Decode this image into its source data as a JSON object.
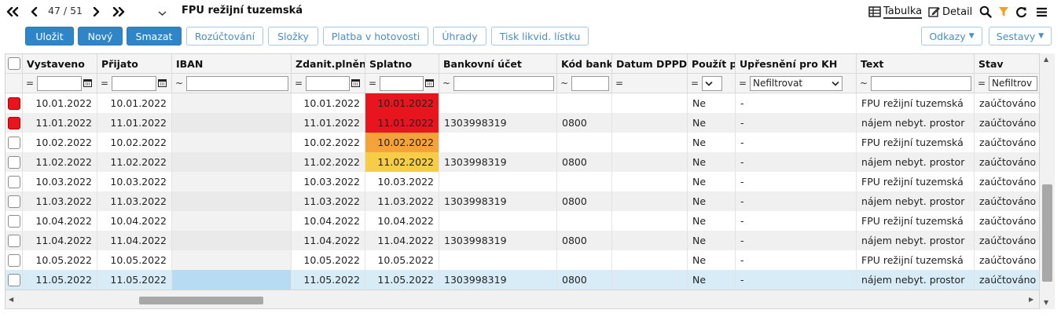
{
  "nav": {
    "counter": "47 / 51",
    "title": "FPU režijní tuzemská"
  },
  "views": {
    "table_label": "Tabulka",
    "detail_label": "Detail",
    "active": "Tabulka"
  },
  "toolbar": {
    "save_label": "Uložit",
    "new_label": "Nový",
    "delete_label": "Smazat",
    "allocation_label": "Rozúčtování",
    "folders_label": "Složky",
    "cash_payment_label": "Platba v hotovosti",
    "payments_label": "Úhrady",
    "print_label": "Tisk likvid. lístku",
    "links_label": "Odkazy",
    "reports_label": "Sestavy"
  },
  "colors": {
    "primary": "#2e86c9",
    "overdue_red": "#e8141e",
    "due_orange": "#f5a23a",
    "due_yellow": "#f7cc47",
    "filter_active": "#f0a21c"
  },
  "grid": {
    "columns": [
      {
        "key": "vystaveno",
        "label": "Vystaveno"
      },
      {
        "key": "prijato",
        "label": "Přijato"
      },
      {
        "key": "iban",
        "label": "IBAN"
      },
      {
        "key": "zdanit",
        "label": "Zdanit.plnění"
      },
      {
        "key": "splatno",
        "label": "Splatno"
      },
      {
        "key": "ucet",
        "label": "Bankovní účet"
      },
      {
        "key": "kod",
        "label": "Kód banky"
      },
      {
        "key": "dppd",
        "label": "Datum DPPD"
      },
      {
        "key": "pouzit",
        "label": "Použít po"
      },
      {
        "key": "kh",
        "label": "Upřesnění pro KH"
      },
      {
        "key": "text",
        "label": "Text"
      },
      {
        "key": "stav",
        "label": "Stav"
      }
    ],
    "filters": {
      "op_equals": "=",
      "op_like": "~",
      "kh_value": "Nefiltrovat",
      "stav_value": "Nefiltrov"
    },
    "rows": [
      {
        "mark": "red",
        "vystaveno": "10.01.2022",
        "prijato": "10.01.2022",
        "iban": "",
        "zdanit": "10.01.2022",
        "splatno": "10.01.2022",
        "splatno_color": "#e8141e",
        "ucet": "",
        "kod": "",
        "dppd": "",
        "pouzit": "Ne",
        "kh": "-",
        "text": "FPU režijní tuzemská",
        "stav": "zaúčtováno"
      },
      {
        "mark": "red",
        "vystaveno": "11.01.2022",
        "prijato": "11.01.2022",
        "iban": "",
        "zdanit": "11.01.2022",
        "splatno": "11.01.2022",
        "splatno_color": "#e8141e",
        "ucet": "1303998319",
        "kod": "0800",
        "dppd": "",
        "pouzit": "Ne",
        "kh": "-",
        "text": "nájem nebyt. prostor",
        "stav": "zaúčtováno"
      },
      {
        "mark": "",
        "vystaveno": "10.02.2022",
        "prijato": "10.02.2022",
        "iban": "",
        "zdanit": "10.02.2022",
        "splatno": "10.02.2022",
        "splatno_color": "#f5a23a",
        "ucet": "",
        "kod": "",
        "dppd": "",
        "pouzit": "Ne",
        "kh": "-",
        "text": "FPU režijní tuzemská",
        "stav": "zaúčtováno"
      },
      {
        "mark": "",
        "vystaveno": "11.02.2022",
        "prijato": "11.02.2022",
        "iban": "",
        "zdanit": "11.02.2022",
        "splatno": "11.02.2022",
        "splatno_color": "#f7cc47",
        "ucet": "1303998319",
        "kod": "0800",
        "dppd": "",
        "pouzit": "Ne",
        "kh": "-",
        "text": "nájem nebyt. prostor",
        "stav": "zaúčtováno"
      },
      {
        "mark": "",
        "vystaveno": "10.03.2022",
        "prijato": "10.03.2022",
        "iban": "",
        "zdanit": "10.03.2022",
        "splatno": "10.03.2022",
        "splatno_color": "",
        "ucet": "",
        "kod": "",
        "dppd": "",
        "pouzit": "Ne",
        "kh": "-",
        "text": "FPU režijní tuzemská",
        "stav": "zaúčtováno"
      },
      {
        "mark": "",
        "vystaveno": "11.03.2022",
        "prijato": "11.03.2022",
        "iban": "",
        "zdanit": "11.03.2022",
        "splatno": "11.03.2022",
        "splatno_color": "",
        "ucet": "1303998319",
        "kod": "0800",
        "dppd": "",
        "pouzit": "Ne",
        "kh": "-",
        "text": "nájem nebyt. prostor",
        "stav": "zaúčtováno"
      },
      {
        "mark": "",
        "vystaveno": "10.04.2022",
        "prijato": "10.04.2022",
        "iban": "",
        "zdanit": "10.04.2022",
        "splatno": "10.04.2022",
        "splatno_color": "",
        "ucet": "",
        "kod": "",
        "dppd": "",
        "pouzit": "Ne",
        "kh": "-",
        "text": "FPU režijní tuzemská",
        "stav": "zaúčtováno"
      },
      {
        "mark": "",
        "vystaveno": "11.04.2022",
        "prijato": "11.04.2022",
        "iban": "",
        "zdanit": "11.04.2022",
        "splatno": "11.04.2022",
        "splatno_color": "",
        "ucet": "1303998319",
        "kod": "0800",
        "dppd": "",
        "pouzit": "Ne",
        "kh": "-",
        "text": "nájem nebyt. prostor",
        "stav": "zaúčtováno"
      },
      {
        "mark": "",
        "vystaveno": "10.05.2022",
        "prijato": "10.05.2022",
        "iban": "",
        "zdanit": "10.05.2022",
        "splatno": "10.05.2022",
        "splatno_color": "",
        "ucet": "",
        "kod": "",
        "dppd": "",
        "pouzit": "Ne",
        "kh": "-",
        "text": "FPU režijní tuzemská",
        "stav": "zaúčtováno"
      },
      {
        "mark": "",
        "selected": true,
        "vystaveno": "11.05.2022",
        "prijato": "11.05.2022",
        "iban": "",
        "zdanit": "11.05.2022",
        "splatno": "11.05.2022",
        "splatno_color": "",
        "ucet": "1303998319",
        "kod": "0800",
        "dppd": "",
        "pouzit": "Ne",
        "kh": "-",
        "text": "nájem nebyt. prostor",
        "stav": "zaúčtováno"
      }
    ]
  }
}
